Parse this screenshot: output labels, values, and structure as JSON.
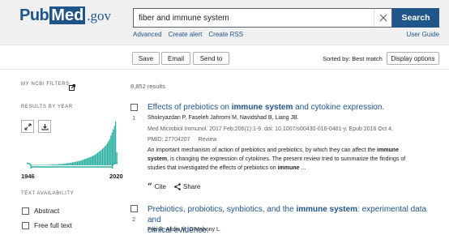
{
  "header": {
    "logo_pub": "Pub",
    "logo_med": "Med",
    "logo_gov": ".gov",
    "search_value": "fiber and immune system",
    "search_button": "Search",
    "links": [
      "Advanced",
      "Create alert",
      "Create RSS"
    ],
    "user_guide": "User Guide"
  },
  "toolbar": {
    "save": "Save",
    "email": "Email",
    "send_to": "Send to",
    "sorted_by": "Sorted by: Best match",
    "display_options": "Display options"
  },
  "sidebar": {
    "my_filters": "MY NCBI FILTERS",
    "results_by_year": "RESULTS BY YEAR",
    "year_start": "1946",
    "year_end": "2020",
    "text_availability": "TEXT AVAILABILITY",
    "filters": [
      "Abstract",
      "Free full text"
    ],
    "histogram": [
      1,
      1,
      1,
      1,
      1,
      1,
      1,
      1,
      1,
      1,
      1,
      1,
      1,
      1,
      1,
      1,
      1,
      1,
      1,
      1,
      2,
      2,
      2,
      2,
      2,
      2,
      3,
      3,
      3,
      3,
      4,
      4,
      4,
      5,
      5,
      5,
      6,
      6,
      7,
      7,
      8,
      8,
      9,
      10,
      10,
      11,
      12,
      13,
      14,
      15,
      16,
      17,
      18,
      19,
      20,
      22,
      23,
      25,
      27,
      29,
      31,
      33,
      35,
      38,
      40,
      43,
      46,
      50,
      55,
      60,
      68,
      75,
      82,
      90,
      100,
      30
    ]
  },
  "results": {
    "count": "8,852 results",
    "items": [
      {
        "num": "1",
        "title_parts": [
          "Effects of prebiotics on ",
          "immune system",
          " and cytokine expression."
        ],
        "authors": "Shokryazdan P, Faseleh Jahromi M, Navidshad B, Liang JB.",
        "citation": "Med Microbiol Immunol. 2017 Feb;206(1):1-9. doi: 10.1007/s00430-016-0481-y. Epub 2016 Oct 4.",
        "pmid": "PMID: 27704207",
        "type": "Review.",
        "snippet_1a": "An important mechanism of action of prebiotics and prebiotics, by which they can affect the ",
        "snippet_1b": "immune",
        "snippet_2a": "system",
        "snippet_2b": ", is changing the expression of cytokines. The present review tried to summarize the findings of",
        "snippet_3a": "studies that investigated the effects of prebiotics on ",
        "snippet_3b": "immune",
        "snippet_3c": " ...",
        "cite": "Cite",
        "share": "Share"
      },
      {
        "num": "2",
        "title_line1_parts": [
          "Prebiotics, probiotics, synbiotics, and the ",
          "immune system",
          ": experimental data and"
        ],
        "title_line2": "clinical evidence.",
        "authors": "Frei R, Akdis M, O'Mahony L."
      }
    ]
  },
  "colors": {
    "brand": "#20558a",
    "histogram": "#2bb1a3"
  }
}
